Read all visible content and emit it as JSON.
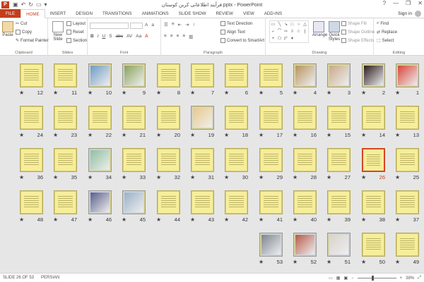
{
  "titlebar": {
    "title": "فرآیند اطلاعاتی کربن کوستان.pptx - PowerPoint",
    "minimize": "—",
    "restore": "❐",
    "close": "✕",
    "help": "?"
  },
  "tabs": [
    "FILE",
    "HOME",
    "INSERT",
    "DESIGN",
    "TRANSITIONS",
    "ANIMATIONS",
    "SLIDE SHOW",
    "REVIEW",
    "VIEW",
    "ADD-INS"
  ],
  "active_tab": "HOME",
  "signin": "Sign in",
  "ribbon": {
    "clipboard": {
      "label": "Clipboard",
      "paste": "Paste",
      "cut": "Cut",
      "copy": "Copy",
      "format_painter": "Format Painter"
    },
    "slides": {
      "label": "Slides",
      "new_slide": "New Slide",
      "layout": "Layout",
      "reset": "Reset",
      "section": "Section"
    },
    "font": {
      "label": "Font"
    },
    "paragraph": {
      "label": "Paragraph",
      "text_direction": "Text Direction",
      "align_text": "Align Text",
      "convert": "Convert to SmartArt"
    },
    "drawing": {
      "label": "Drawing",
      "arrange": "Arrange",
      "quick_styles": "Quick Styles",
      "shape_fill": "Shape Fill",
      "shape_outline": "Shape Outline",
      "shape_effects": "Shape Effects"
    },
    "editing": {
      "label": "Editing",
      "find": "Find",
      "replace": "Replace",
      "select": "Select"
    }
  },
  "slides": [
    {
      "n": "1",
      "kind": "photo",
      "color": "#d9453b"
    },
    {
      "n": "2",
      "kind": "photo",
      "color": "#2b1b1b"
    },
    {
      "n": "3",
      "kind": "photo",
      "color": "#c9a98a"
    },
    {
      "n": "4",
      "kind": "photo",
      "color": "#b8935e"
    },
    {
      "n": "5",
      "kind": "text"
    },
    {
      "n": "6",
      "kind": "text"
    },
    {
      "n": "7",
      "kind": "text"
    },
    {
      "n": "8",
      "kind": "text"
    },
    {
      "n": "9",
      "kind": "photo",
      "color": "#8aa35a"
    },
    {
      "n": "10",
      "kind": "photo",
      "color": "#6f9bc4"
    },
    {
      "n": "11",
      "kind": "text"
    },
    {
      "n": "12",
      "kind": "text"
    },
    {
      "n": "13",
      "kind": "text"
    },
    {
      "n": "14",
      "kind": "text"
    },
    {
      "n": "15",
      "kind": "text"
    },
    {
      "n": "16",
      "kind": "text"
    },
    {
      "n": "17",
      "kind": "text"
    },
    {
      "n": "18",
      "kind": "text"
    },
    {
      "n": "19",
      "kind": "photo",
      "color": "#e9c98a"
    },
    {
      "n": "20",
      "kind": "text"
    },
    {
      "n": "21",
      "kind": "text"
    },
    {
      "n": "22",
      "kind": "text"
    },
    {
      "n": "23",
      "kind": "text"
    },
    {
      "n": "24",
      "kind": "text"
    },
    {
      "n": "25",
      "kind": "text"
    },
    {
      "n": "26",
      "kind": "text",
      "selected": true
    },
    {
      "n": "27",
      "kind": "text"
    },
    {
      "n": "28",
      "kind": "text"
    },
    {
      "n": "29",
      "kind": "text"
    },
    {
      "n": "30",
      "kind": "text"
    },
    {
      "n": "31",
      "kind": "text"
    },
    {
      "n": "32",
      "kind": "text"
    },
    {
      "n": "33",
      "kind": "text"
    },
    {
      "n": "34",
      "kind": "photo",
      "color": "#8fbf9f"
    },
    {
      "n": "35",
      "kind": "text"
    },
    {
      "n": "36",
      "kind": "text"
    },
    {
      "n": "37",
      "kind": "text"
    },
    {
      "n": "38",
      "kind": "text"
    },
    {
      "n": "39",
      "kind": "text"
    },
    {
      "n": "40",
      "kind": "text"
    },
    {
      "n": "41",
      "kind": "text"
    },
    {
      "n": "42",
      "kind": "text"
    },
    {
      "n": "43",
      "kind": "text"
    },
    {
      "n": "44",
      "kind": "text"
    },
    {
      "n": "45",
      "kind": "photo",
      "color": "#9ab0c8"
    },
    {
      "n": "46",
      "kind": "photo",
      "color": "#5a5f8a"
    },
    {
      "n": "47",
      "kind": "text"
    },
    {
      "n": "48",
      "kind": "text"
    },
    {
      "n": "49",
      "kind": "text"
    },
    {
      "n": "50",
      "kind": "text"
    },
    {
      "n": "51",
      "kind": "photo",
      "color": "#d8d2cc"
    },
    {
      "n": "52",
      "kind": "photo",
      "color": "#b65a4a"
    },
    {
      "n": "53",
      "kind": "photo",
      "color": "#7d8590"
    }
  ],
  "status": {
    "slide_info": "SLIDE 26 OF 53",
    "language": "PERSIAN",
    "zoom": "38%",
    "zoom_minus": "−",
    "zoom_plus": "+"
  },
  "colors": {
    "accent": "#c43e1c",
    "slide_bg": "#f7ee9a"
  }
}
